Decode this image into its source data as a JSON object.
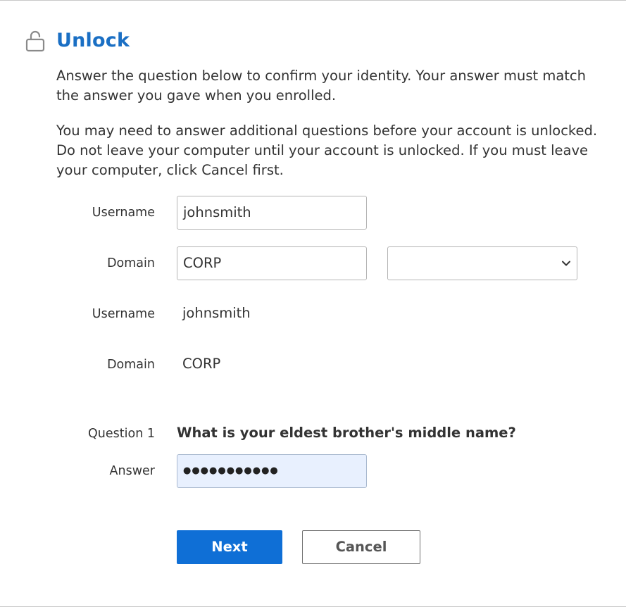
{
  "header": {
    "title": "Unlock",
    "icon": "unlock-icon"
  },
  "instructions": {
    "paragraph1": "Answer the question below to confirm your identity. Your answer must match the answer you gave when you enrolled.",
    "paragraph2": "You may need to answer additional questions before your account is unlocked. Do not leave your computer until your account is unlocked. If you must leave your computer, click Cancel first."
  },
  "form": {
    "username_label": "Username",
    "username_value": "johnsmith",
    "domain_label": "Domain",
    "domain_value": "CORP",
    "domain_select_value": ""
  },
  "summary": {
    "username_label": "Username",
    "username_value": "johnsmith",
    "domain_label": "Domain",
    "domain_value": "CORP"
  },
  "question": {
    "label": "Question 1",
    "text": "What is your eldest brother's middle name?",
    "answer_label": "Answer",
    "answer_masked": "●●●●●●●●●●●"
  },
  "buttons": {
    "next": "Next",
    "cancel": "Cancel"
  },
  "colors": {
    "accent": "#1a6fc4",
    "primary_button": "#0f6fd6",
    "autofill_background": "#e8f0fe"
  }
}
